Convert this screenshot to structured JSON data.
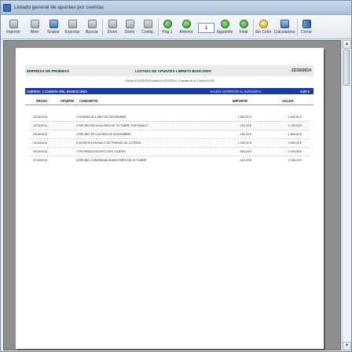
{
  "window": {
    "title": "Listado general de apuntes por cuentas"
  },
  "toolbar": {
    "buttons": [
      {
        "label": "Imprimir",
        "icon": "printer-icon"
      },
      {
        "label": "Abrir",
        "icon": "open-folder-icon"
      },
      {
        "label": "Grabar",
        "icon": "save-icon"
      },
      {
        "label": "Exportar",
        "icon": "export-icon"
      },
      {
        "label": "Buscar",
        "icon": "search-icon"
      },
      {
        "label": "Zoom",
        "icon": "zoom-in-icon"
      },
      {
        "label": "Zoom",
        "icon": "zoom-out-icon"
      },
      {
        "label": "Config.",
        "icon": "config-icon"
      },
      {
        "label": "Pag 1",
        "icon": "first-page-icon"
      },
      {
        "label": "Anterior",
        "icon": "previous-icon"
      },
      {
        "label": "Siguiente",
        "icon": "next-icon"
      },
      {
        "label": "Final",
        "icon": "last-page-icon"
      },
      {
        "label": "Sin Color",
        "icon": "no-color-icon"
      },
      {
        "label": "Calculadora",
        "icon": "calculator-icon"
      },
      {
        "label": "Cerrar",
        "icon": "exit-door-icon"
      }
    ],
    "page_value": "1"
  },
  "report": {
    "company": "EMPRESA DE PRUEBAS",
    "title": "LISTADO DE APUNTES LIBRETA BANCARIA",
    "date": "22/10/2014",
    "subtitle": "Desde el 01/01/2014 hasta el 31/12/2014, Cuentas de la 1 hasta la 202",
    "account": "CUENTA: 1 CUENTA DEL BANCO UNO",
    "previous_balance_label": "SALDO ANTERIOR AL 01/01/2014 :",
    "previous_balance": "0,00 €",
    "columns": {
      "fecha": "FECHA",
      "apunte": "APUNTE",
      "concepto": "CONCEPTO",
      "importe": "IMPORTE",
      "saldo": "SALDO"
    },
    "rows": [
      {
        "fecha": "22/10/2014",
        "concepto": "1 NOMINA DEL MES DE NOVIEMBRE",
        "importe": "1.852,51 €",
        "saldo": "1.852,51 €"
      },
      {
        "fecha": "22/10/2014",
        "concepto": "2 RECIBO DE AGUA MES DE OCTUBRE POR BANCO",
        "importe": "-102,23 €",
        "saldo": "1.750,28 €"
      },
      {
        "fecha": "23/10/2014",
        "concepto": "4 RECIBO DE LUZ MES DE NOVIEMBRE",
        "importe": "-150,25 €",
        "saldo": "1.600,03 €"
      },
      {
        "fecha": "24/10/2014",
        "concepto": "6 INGRESO EN BACO DE PREMIO DE LOTERIA",
        "importe": "1.200,32 €",
        "saldo": "2.800,35 €"
      },
      {
        "fecha": "25/10/2014",
        "concepto": "7 RETIRADA EN EFECTIVO CAJERO",
        "importe": "-350,00 €",
        "saldo": "2.450,35 €"
      },
      {
        "fecha": "27/10/2014",
        "concepto": "8 RECIBO COMUNIDAD BANCO MES DE OCTUBRE",
        "importe": "-112,23 €",
        "saldo": "2.338,12 €"
      }
    ]
  }
}
